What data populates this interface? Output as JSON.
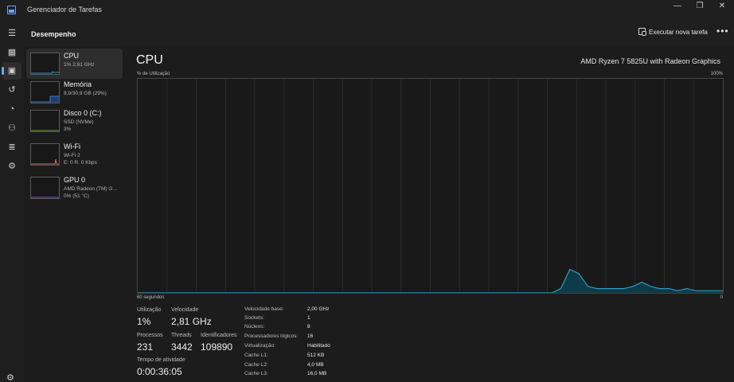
{
  "window": {
    "title": "Gerenciador de Tarefas",
    "controls": [
      "—",
      "❐",
      "✕"
    ]
  },
  "rail": {
    "items": [
      {
        "name": "hamburger-menu-icon",
        "glyph": "☰"
      },
      {
        "name": "processes-icon",
        "glyph": "▦"
      },
      {
        "name": "performance-icon",
        "glyph": "▣"
      },
      {
        "name": "app-history-icon",
        "glyph": "↺"
      },
      {
        "name": "startup-apps-icon",
        "glyph": "◔"
      },
      {
        "name": "users-icon",
        "glyph": "⚇"
      },
      {
        "name": "details-icon",
        "glyph": "≣"
      },
      {
        "name": "services-icon",
        "glyph": "⚙"
      }
    ],
    "settings_glyph": "⚙"
  },
  "header": {
    "title": "Desempenho",
    "run_task": "Executar nova tarefa",
    "more": "•••"
  },
  "devices": [
    {
      "name": "CPU",
      "lines": [
        "1% 2,81 GHz"
      ]
    },
    {
      "name": "Memória",
      "lines": [
        "8,9/30,9 GB (29%)"
      ]
    },
    {
      "name": "Disco 0 (C:)",
      "lines": [
        "SSD (NVMe)",
        "3%"
      ]
    },
    {
      "name": "Wi-Fi",
      "lines": [
        "Wi-Fi 2",
        "E: 0 R: 0 Kbps"
      ]
    },
    {
      "name": "GPU 0",
      "lines": [
        "AMD Radeon (TM) G...",
        "0% (51 °C)"
      ]
    }
  ],
  "main": {
    "title": "CPU",
    "model": "AMD Ryzen 7 5825U with Radeon Graphics",
    "axis": {
      "top_left": "% de Utilização",
      "top_right": "100%",
      "bottom_left": "60 segundos",
      "bottom_right": "0"
    },
    "stats": {
      "utilizacao_label": "Utilização",
      "utilizacao_value": "1%",
      "velocidade_label": "Velocidade",
      "velocidade_value": "2,81 GHz",
      "processos_label": "Processos",
      "processos_value": "231",
      "threads_label": "Threads",
      "threads_value": "3442",
      "identificadores_label": "Identificadores",
      "identificadores_value": "109890",
      "tempo_label": "Tempo de atividade",
      "tempo_value": "0:00:36:05"
    },
    "details": [
      {
        "label": "Velocidade base:",
        "value": "2,00 GHz"
      },
      {
        "label": "Sockets:",
        "value": "1"
      },
      {
        "label": "Núcleos:",
        "value": "8"
      },
      {
        "label": "Processadores lógicos:",
        "value": "16"
      },
      {
        "label": "Virtualização:",
        "value": "Habilitado"
      },
      {
        "label": "Cache L1:",
        "value": "512 KB"
      },
      {
        "label": "Cache L2:",
        "value": "4,0 MB"
      },
      {
        "label": "Cache L3:",
        "value": "16,0 MB"
      }
    ]
  },
  "colors": {
    "cpu_line": "#2f9bbf",
    "cpu_fill": "#0f3a4a",
    "memory": "#3a7bd5",
    "disk": "#67a33a",
    "wifi": "#d06a6a",
    "gpu": "#7e57c2"
  },
  "chart_data": {
    "type": "area",
    "x_range_seconds": [
      60,
      0
    ],
    "ylim": [
      0,
      100
    ],
    "values": [
      0,
      0,
      0,
      0,
      0,
      0,
      0,
      0,
      0,
      0,
      0,
      0,
      0,
      0,
      0,
      0,
      0,
      0,
      0,
      0,
      0,
      0,
      0,
      0,
      0,
      0,
      0,
      0,
      0,
      0,
      0,
      0,
      0,
      0,
      0,
      0,
      0,
      0,
      0,
      0,
      0,
      0,
      0,
      0,
      0,
      0,
      0,
      2,
      11,
      9,
      3,
      2,
      2,
      2,
      2,
      3,
      5,
      3,
      2,
      2,
      1,
      2,
      1,
      1,
      1,
      1
    ]
  }
}
